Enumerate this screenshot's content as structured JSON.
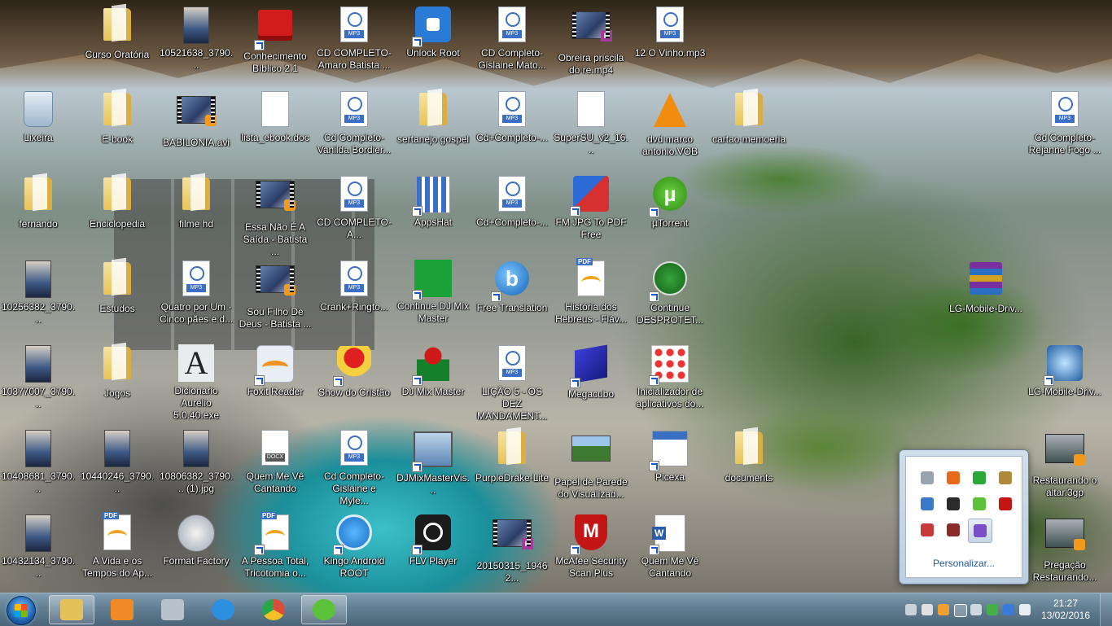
{
  "desktop": {
    "icons": [
      {
        "label": "Curso Oratória",
        "icon": "folder-icon"
      },
      {
        "label": "10521638_3790...",
        "icon": "image-thumbnail-icon"
      },
      {
        "label": "Conhecimento Bíblico 2.1",
        "icon": "red-book-icon"
      },
      {
        "label": "CD COMPLETO- Amaro Batista ...",
        "icon": "mp3-file-icon"
      },
      {
        "label": "Unlock Root",
        "icon": "android-lock-icon"
      },
      {
        "label": "CD Completo- Gislaine Mato...",
        "icon": "mp3-file-icon"
      },
      {
        "label": "Obreira priscila do re.mp4",
        "icon": "video-thumbnail-icon"
      },
      {
        "label": "12 O Vinho.mp3",
        "icon": "mp3-file-icon"
      },
      {
        "label": "Lixeira",
        "icon": "recycle-bin-icon"
      },
      {
        "label": "E-book",
        "icon": "folder-icon"
      },
      {
        "label": "BABILONIA.avi",
        "icon": "video-thumbnail-icon"
      },
      {
        "label": "lista_ebook.doc",
        "icon": "doc-file-icon"
      },
      {
        "label": "Cd Completo- Vanilda Bordier...",
        "icon": "mp3-file-icon"
      },
      {
        "label": "sertanejo gospel",
        "icon": "folder-icon"
      },
      {
        "label": "Cd+Completo-...",
        "icon": "mp3-file-icon"
      },
      {
        "label": "SuperSU_v2_16...",
        "icon": "blank-file-icon"
      },
      {
        "label": "dvd marco antonio.VOB",
        "icon": "vlc-icon"
      },
      {
        "label": "cartao memoeria",
        "icon": "folder-icon"
      },
      {
        "label": "Cd Completo- Rejanne Fogo ...",
        "icon": "mp3-file-icon"
      },
      {
        "label": "fernando",
        "icon": "folder-icon"
      },
      {
        "label": "Enciclopedia",
        "icon": "folder-icon"
      },
      {
        "label": "filme hd",
        "icon": "folder-icon"
      },
      {
        "label": "Essa Não É A Saída - Batista ...",
        "icon": "video-thumbnail-icon"
      },
      {
        "label": "CD COMPLETO-A...",
        "icon": "mp3-file-icon"
      },
      {
        "label": "AppsHat",
        "icon": "apps-icon"
      },
      {
        "label": "Cd+Completo-...",
        "icon": "mp3-file-icon"
      },
      {
        "label": "FM JPG To PDF Free",
        "icon": "jpg-pdf-icon"
      },
      {
        "label": "µTorrent",
        "icon": "utorrent-icon"
      },
      {
        "label": "10256382_3790...",
        "icon": "image-thumbnail-icon"
      },
      {
        "label": "Estudos",
        "icon": "folder-icon"
      },
      {
        "label": "Quatro por Um - Cinco pães e d...",
        "icon": "mp3-file-icon"
      },
      {
        "label": "Sou Filho De Deus - Batista ...",
        "icon": "video-thumbnail-icon"
      },
      {
        "label": "Crank+Ringto...",
        "icon": "mp3-file-icon"
      },
      {
        "label": "Continue DJ Mix Master",
        "icon": "green-box-icon"
      },
      {
        "label": "Free Translation",
        "icon": "blue-b-icon"
      },
      {
        "label": "História dos Hebreus - Fláv...",
        "icon": "pdf-file-icon"
      },
      {
        "label": "Continue DESPROTET...",
        "icon": "green-download-icon"
      },
      {
        "label": "LG-Mobile-Driv...",
        "icon": "winrar-icon"
      },
      {
        "label": "10377007_3790...",
        "icon": "image-thumbnail-icon"
      },
      {
        "label": "Jogos",
        "icon": "folder-icon"
      },
      {
        "label": "Dicionario Aurelio 5.0.40.exe",
        "icon": "dictionary-icon"
      },
      {
        "label": "Foxit Reader",
        "icon": "foxit-icon"
      },
      {
        "label": "Show do Cristão",
        "icon": "show-cristao-icon"
      },
      {
        "label": "DJ Mix Master",
        "icon": "dj-mix-master-icon"
      },
      {
        "label": "LIÇÃO 5 - OS DEZ MANDAMENT...",
        "icon": "mp3-file-icon"
      },
      {
        "label": "Megacubo",
        "icon": "cube-icon"
      },
      {
        "label": "Inicializador de aplicativos do...",
        "icon": "apps-grid-icon"
      },
      {
        "label": "LG-Mobile-Driv...",
        "icon": "blue-app-icon"
      },
      {
        "label": "10408681_3790...",
        "icon": "image-thumbnail-icon"
      },
      {
        "label": "10440246_3790...",
        "icon": "image-thumbnail-icon"
      },
      {
        "label": "10806382_3790... (1).jpg",
        "icon": "image-thumbnail-icon"
      },
      {
        "label": "Quem Me Vê Cantando",
        "icon": "docx-file-icon"
      },
      {
        "label": "Cd Completo- Gislaine e Myle...",
        "icon": "mp3-file-icon"
      },
      {
        "label": "DJMixMasterVis...",
        "icon": "computer-icon"
      },
      {
        "label": "PurpleDrake-Lite",
        "icon": "folder-icon"
      },
      {
        "label": "Papel de Parede do Visualizad...",
        "icon": "landscape-thumbnail-icon"
      },
      {
        "label": "Picexa",
        "icon": "picexa-icon"
      },
      {
        "label": "documents",
        "icon": "folder-icon"
      },
      {
        "label": "Restaurando o altar.3gp",
        "icon": "video-thumbnail-icon"
      },
      {
        "label": "10432134_3790...",
        "icon": "image-thumbnail-icon"
      },
      {
        "label": "A Vida e os Tempos do Ap...",
        "icon": "pdf-file-icon"
      },
      {
        "label": "Format Factory",
        "icon": "format-factory-icon"
      },
      {
        "label": "A Pessoa Total, Tricotomia o...",
        "icon": "pdf-file-icon"
      },
      {
        "label": "Kingo Android ROOT",
        "icon": "kingo-icon"
      },
      {
        "label": "FLV Player",
        "icon": "flv-player-icon"
      },
      {
        "label": "20150315_19462...",
        "icon": "video-thumbnail-icon"
      },
      {
        "label": "McAfee Security Scan Plus",
        "icon": "mcafee-icon"
      },
      {
        "label": "Quem Me Vê Cantando",
        "icon": "word-doc-icon"
      },
      {
        "label": "Pregação Restaurando...",
        "icon": "video-thumbnail-icon"
      }
    ]
  },
  "tray_popup": {
    "customize_label": "Personalizar...",
    "icons": [
      {
        "name": "volume-icon",
        "color": "#9aa4b0"
      },
      {
        "name": "sbd-icon",
        "color": "#e76a18"
      },
      {
        "name": "check-shield-icon",
        "color": "#2aa83a"
      },
      {
        "name": "package-icon",
        "color": "#b08a3a"
      },
      {
        "name": "monitor-icon",
        "color": "#3a78c8"
      },
      {
        "name": "webcam-icon",
        "color": "#2b2b2b"
      },
      {
        "name": "utorrent-tray-icon",
        "color": "#5cc23a"
      },
      {
        "name": "mcafee-tray-icon",
        "color": "#c41515"
      },
      {
        "name": "action-center-flag-icon",
        "color": "#c83a3a"
      },
      {
        "name": "usb-eject-icon",
        "color": "#8a2a2a"
      },
      {
        "name": "pen-icon",
        "color": "#7a4ec8"
      }
    ]
  },
  "taskbar": {
    "apps": [
      {
        "name": "explorer-icon",
        "color": "#e5c15a",
        "active": true
      },
      {
        "name": "media-player-icon",
        "color": "#f08a24",
        "active": false
      },
      {
        "name": "camera-app-icon",
        "color": "#b8c2cc",
        "active": false
      },
      {
        "name": "internet-explorer-icon",
        "color": "#2d8fe0",
        "active": false
      },
      {
        "name": "chrome-icon",
        "color": "#dd4b39",
        "active": false
      },
      {
        "name": "utorrent-taskbar-icon",
        "color": "#5cc23a",
        "active": true
      }
    ],
    "tray_icons": [
      "webcam-tray-icon",
      "wireless-icon",
      "pen-tray-icon",
      "show-hidden-icons-icon",
      "power-icon",
      "network-check-icon",
      "bluetooth-icon",
      "signal-icon"
    ],
    "clock": {
      "time": "21:27",
      "date": "13/02/2016"
    }
  }
}
